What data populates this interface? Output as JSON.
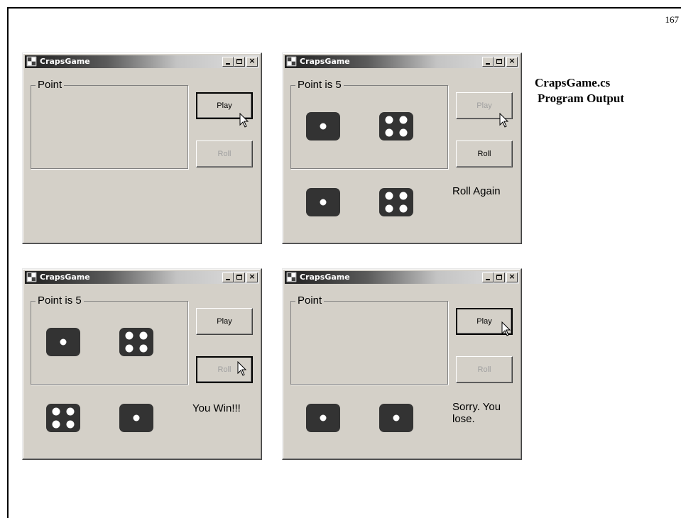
{
  "page_number": "167",
  "caption": {
    "line1": "CrapsGame.cs",
    "line2": "Program Output"
  },
  "icons": {
    "app": "app-icon",
    "minimize": "minimize-icon",
    "maximize": "maximize-icon",
    "close": "close-icon",
    "cursor": "mouse-cursor-icon"
  },
  "windows": [
    {
      "title": "CrapsGame",
      "group_label": "Point",
      "play_label": "Play",
      "roll_label": "Roll",
      "message": "",
      "point_dice": [],
      "roll_dice": [],
      "play_state": "focused",
      "roll_state": "disabled"
    },
    {
      "title": "CrapsGame",
      "group_label": "Point is 5",
      "play_label": "Play",
      "roll_label": "Roll",
      "message": "Roll Again",
      "point_dice": [
        1,
        4
      ],
      "roll_dice": [
        1,
        4
      ],
      "play_state": "disabled",
      "roll_state": "enabled"
    },
    {
      "title": "CrapsGame",
      "group_label": "Point is 5",
      "play_label": "Play",
      "roll_label": "Roll",
      "message": "You Win!!!",
      "point_dice": [
        1,
        4
      ],
      "roll_dice": [
        4,
        1
      ],
      "play_state": "enabled",
      "roll_state": "disabled"
    },
    {
      "title": "CrapsGame",
      "group_label": "Point",
      "play_label": "Play",
      "roll_label": "Roll",
      "message": "Sorry. You lose.",
      "point_dice": [],
      "roll_dice": [
        1,
        1
      ],
      "play_state": "focused",
      "roll_state": "disabled"
    }
  ]
}
